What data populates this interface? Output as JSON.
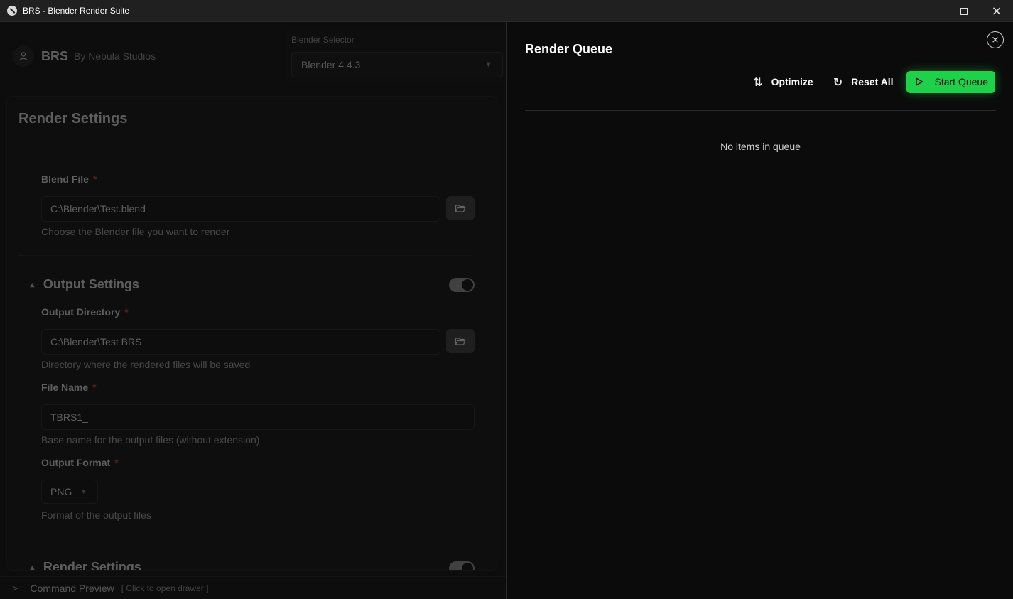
{
  "window": {
    "title": "BRS - Blender Render Suite"
  },
  "brand": {
    "name": "BRS",
    "subtitle": "By Nebula Studios"
  },
  "blender_selector": {
    "label": "Blender Selector",
    "value": "Blender 4.4.3"
  },
  "render_settings": {
    "title": "Render Settings",
    "blend_file": {
      "label": "Blend File",
      "required_mark": "*",
      "value": "C:\\Blender\\Test.blend",
      "help": "Choose the Blender file you want to render"
    },
    "output_section": {
      "title": "Output Settings",
      "enabled": true,
      "output_directory": {
        "label": "Output Directory",
        "required_mark": "*",
        "value": "C:\\Blender\\Test BRS",
        "help": "Directory where the rendered files will be saved"
      },
      "file_name": {
        "label": "File Name",
        "required_mark": "*",
        "value": "TBRS1_",
        "help": "Base name for the output files (without extension)"
      },
      "output_format": {
        "label": "Output Format",
        "required_mark": "*",
        "value": "PNG",
        "help": "Format of the output files"
      }
    },
    "render_section": {
      "title": "Render Settings",
      "enabled": true
    }
  },
  "command_bar": {
    "icon": ">_",
    "label": "Command Preview",
    "hint": "[ Click to open drawer ]"
  },
  "render_queue": {
    "title": "Render Queue",
    "optimize_label": "Optimize",
    "reset_label": "Reset All",
    "start_label": "Start Queue",
    "empty_text": "No items in queue"
  },
  "colors": {
    "accent_green": "#1fd14a",
    "required_red": "#b33a3a",
    "background": "#0b0b0b"
  },
  "icons": {
    "close": "×",
    "optimize": "⇅",
    "reset": "↻"
  }
}
